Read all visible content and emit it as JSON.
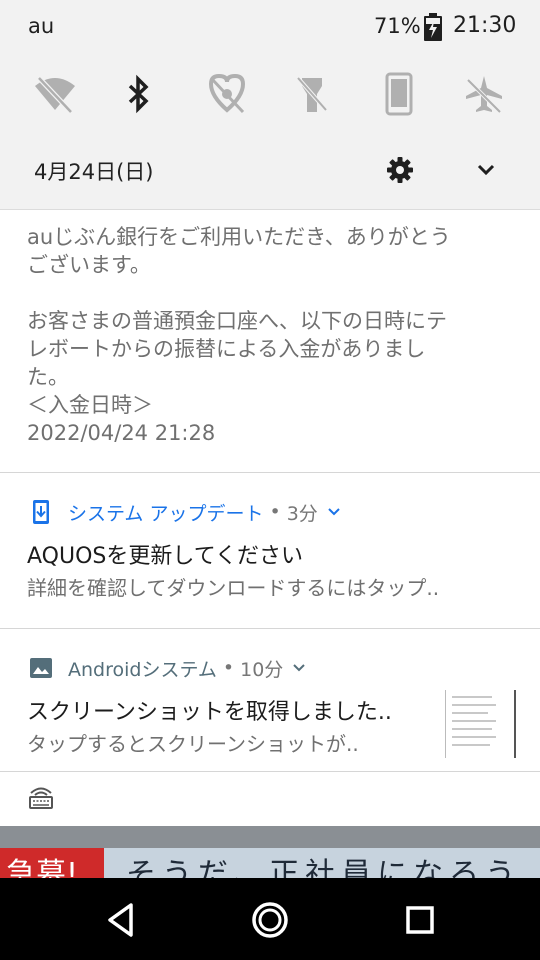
{
  "status_bar": {
    "carrier": "au",
    "battery_percent": "71%",
    "time": "21:30"
  },
  "quick_settings": {
    "tiles": [
      {
        "icon": "wifi-off-icon",
        "state": "off"
      },
      {
        "icon": "bluetooth-icon",
        "state": "on"
      },
      {
        "icon": "hotspot-off-icon",
        "state": "off"
      },
      {
        "icon": "flashlight-off-icon",
        "state": "off"
      },
      {
        "icon": "auto-rotate-icon",
        "state": "off"
      },
      {
        "icon": "airplane-off-icon",
        "state": "off"
      }
    ],
    "date": "4月24日(日)",
    "settings_icon": "gear-icon",
    "expand_icon": "chevron-down-icon"
  },
  "notifications": {
    "bank": {
      "text": "auじぶん銀行をご利用いただき、ありがとう\nございます。\n\nお客さまの普通預金口座へ、以下の日時にテ\nレボートからの振替による入金がありまし\nた。\n＜入金日時＞\n2022/04/24 21:28"
    },
    "system_update": {
      "app_name": "システム アップデート",
      "separator": "•",
      "time": "3分",
      "title": "AQUOSを更新してください",
      "body": "詳細を確認してダウンロードするにはタップ..",
      "accent_color": "#1a73e8"
    },
    "screenshot": {
      "app_name": "Androidシステム",
      "separator": "•",
      "time": "10分",
      "title": "スクリーンショットを取得しました..",
      "body": "タップするとスクリーンショットが..",
      "app_color": "#546e7a"
    }
  },
  "background_app": {
    "red_text": "急募!",
    "banner_text": "そうだ、正社員になろう"
  },
  "nav_bar": {
    "back_icon": "back-triangle-icon",
    "home_icon": "home-circle-icon",
    "recents_icon": "recents-square-icon"
  }
}
